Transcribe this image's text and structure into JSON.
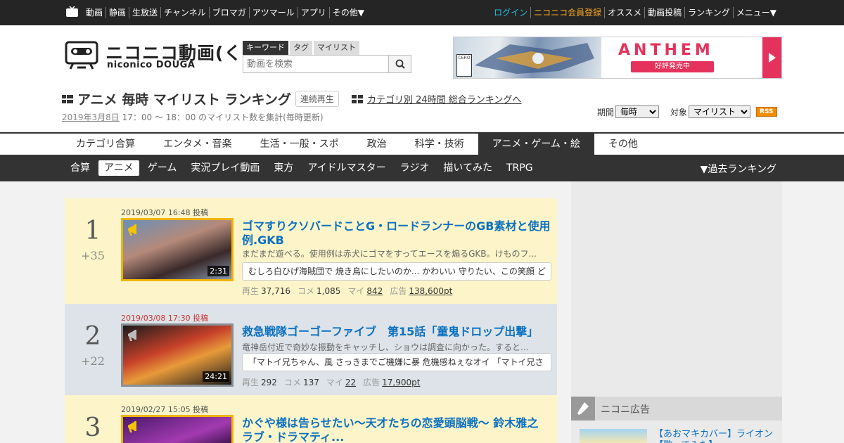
{
  "topnav": {
    "left": [
      "動画",
      "静画",
      "生放送",
      "チャンネル",
      "ブロマガ",
      "アツマール",
      "アプリ",
      "その他▼"
    ],
    "login": "ログイン",
    "register": "ニコニコ会員登録",
    "right": [
      "オススメ",
      "動画投稿",
      "ランキング",
      "メニュー▼"
    ]
  },
  "logo": {
    "jp": "ニコニコ動画(く)",
    "en": "niconico DOUGA"
  },
  "search": {
    "tabs": [
      "キーワード",
      "タグ",
      "マイリスト"
    ],
    "placeholder": "動画を検索"
  },
  "ad_banner": {
    "brand": "ANTHEM",
    "tagline": "好評発売中",
    "rating": "CERO"
  },
  "page": {
    "title": "アニメ 毎時 マイリスト ランキング",
    "continuous_play": "連続再生",
    "category_link": "カテゴリ別 24時間 総合ランキングへ",
    "date": "2019年3月8日",
    "note": " 17：00 ～ 18：00 のマイリスト数を集計(毎時更新)"
  },
  "filters": {
    "period_label": "期間",
    "period_value": "毎時",
    "target_label": "対象",
    "target_value": "マイリスト",
    "rss": "RSS"
  },
  "categories": [
    "カテゴリ合算",
    "エンタメ・音楽",
    "生活・一般・スポ",
    "政治",
    "科学・技術",
    "アニメ・ゲーム・絵",
    "その他"
  ],
  "active_category": 5,
  "subcategories": [
    "合算",
    "アニメ",
    "ゲーム",
    "実況プレイ動画",
    "東方",
    "アイドルマスター",
    "ラジオ",
    "描いてみた",
    "TRPG"
  ],
  "active_subcategory": 1,
  "past_ranking": "▼過去ランキング",
  "ranking": [
    {
      "rank": "1",
      "delta": "+35",
      "posted": "2019/03/07 16:48 投稿",
      "new": false,
      "title": "ゴマすりクソバードことG・ロードランナーのGB素材と使用例.GKB",
      "desc": "まだまだ遊べる。使用例は赤犬にゴマをすってエースを煽るGKB。けものフ...",
      "comments": "むしろ白ひげ海賊団で 焼き鳥にしたいのか... かわいい 守りたい、この笑顔 ど",
      "duration": "2:31",
      "views": "37,716",
      "coms": "1,085",
      "mylist": "842",
      "adpt": "138,600pt",
      "style": "gold"
    },
    {
      "rank": "2",
      "delta": "+22",
      "posted": "2019/03/08 17:30 投稿",
      "new": true,
      "title": "救急戦隊ゴーゴーファイブ　第15話「童鬼ドロップ出撃」",
      "desc": "竜神岳付近で奇妙な振動をキャッチし、ショウは調査に向かった。すると...",
      "comments": "「マトイ兄ちゃん、風 さっきまでご機嫌に暴 危機感ねぇなオイ 「マトイ兄さ",
      "duration": "24:21",
      "views": "292",
      "coms": "137",
      "mylist": "22",
      "adpt": "17,900pt",
      "style": "gray"
    },
    {
      "rank": "3",
      "delta": "",
      "posted": "2019/02/27 15:05 投稿",
      "new": false,
      "title": "かぐや様は告らせたい～天才たちの恋愛頭脳戦～ 鈴木雅之 ラブ・ドラマティ...",
      "desc": "",
      "comments": "",
      "duration": "",
      "views": "",
      "coms": "",
      "mylist": "",
      "adpt": "",
      "style": "gold"
    }
  ],
  "stat_labels": {
    "views": "再生",
    "coms": "コメ",
    "mylist": "マイ",
    "ad": "広告"
  },
  "sidebar": {
    "ads_title": "ニコニ広告",
    "ad_item_title": "【あおマキカバー】ライオン【歌ってみた】"
  }
}
